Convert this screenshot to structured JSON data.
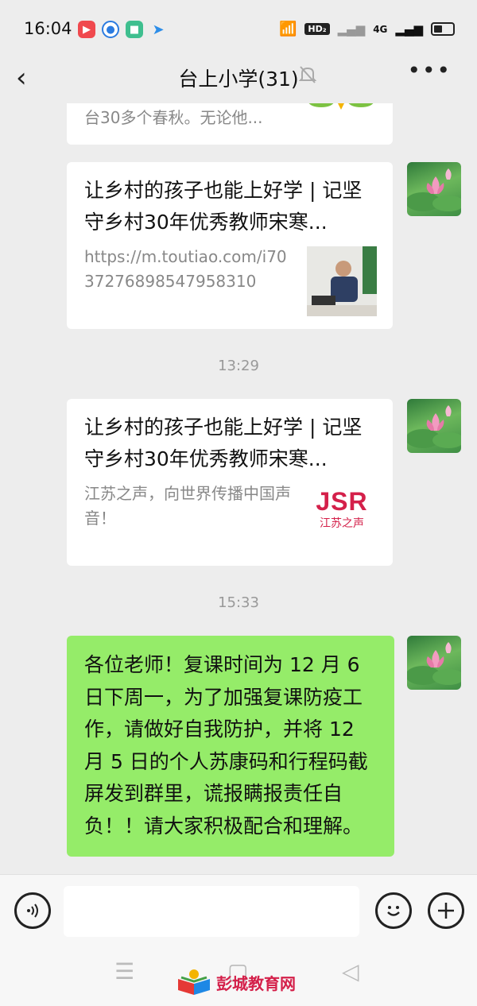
{
  "status_bar": {
    "time": "16:04",
    "hd_label": "HD₂",
    "network_label": "4G"
  },
  "header": {
    "back_icon": "‹",
    "title": "台上小学(31)",
    "mute_icon": "🔕",
    "more_icon": "•••"
  },
  "messages": {
    "partial_card": {
      "desc": "台30多个春秋。无论他..."
    },
    "card1": {
      "title": "让乡村的孩子也能上好学 | 记坚守乡村30年优秀教师宋寒...",
      "desc": "https://m.toutiao.com/i7037276898547958310"
    },
    "time1": "13:29",
    "card2": {
      "title": "让乡村的孩子也能上好学 | 记坚守乡村30年优秀教师宋寒...",
      "desc": "江苏之声，向世界传播中国声音！",
      "logo_main": "JSR",
      "logo_sub": "江苏之声"
    },
    "time2": "15:33",
    "text_message": "各位老师！复课时间为 12 月 6 日下周一，为了加强复课防疫工作，请做好自我防护，并将 12 月 5 日的个人苏康码和行程码截屏发到群里，谎报瞒报责任自负！！请大家积极配合和理解。"
  },
  "input_bar": {
    "voice_icon": "◉",
    "emoji_icon": "☺",
    "plus_icon": "+"
  },
  "system_nav": {
    "menu_icon": "☰",
    "home_icon": "▢",
    "back_icon": "◁"
  },
  "watermark": {
    "text": "彭城教育网"
  },
  "colors": {
    "bubble_green": "#95ec69",
    "background": "#ededed",
    "jsr_red": "#d4204a"
  }
}
